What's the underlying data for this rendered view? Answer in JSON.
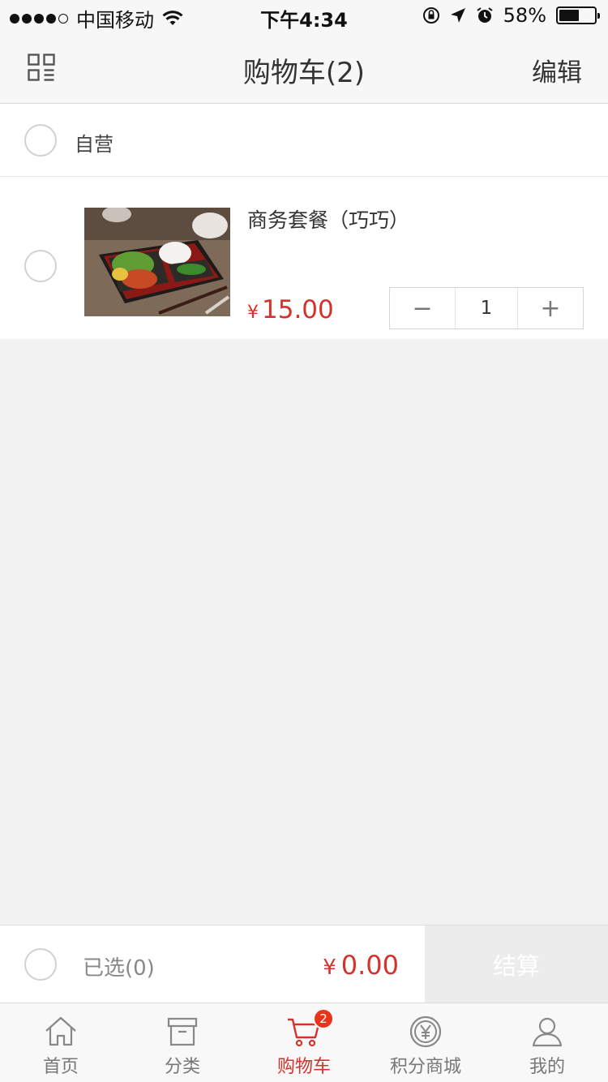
{
  "status_bar": {
    "carrier": "中国移动",
    "time": "下午4:34",
    "battery_text": "58%",
    "battery_level": 0.58,
    "signal_bars_filled": 4,
    "signal_bars_total": 5
  },
  "nav": {
    "title": "购物车(2)",
    "edit_label": "编辑",
    "left_icon": "grid-icon"
  },
  "store": {
    "name": "自营",
    "checked": false
  },
  "cart_items": [
    {
      "name": "商务套餐（巧巧）",
      "price_currency": "¥",
      "price": "15.00",
      "quantity": "1",
      "minus_label": "−",
      "plus_label": "+",
      "checked": false
    }
  ],
  "checkout": {
    "selected_label": "已选(0)",
    "total_currency": "¥",
    "total": "0.00",
    "button_label": "结算"
  },
  "tabs": [
    {
      "label": "首页",
      "icon": "home-icon",
      "active": false
    },
    {
      "label": "分类",
      "icon": "category-box-icon",
      "active": false
    },
    {
      "label": "购物车",
      "icon": "cart-icon",
      "active": true,
      "badge": "2"
    },
    {
      "label": "积分商城",
      "icon": "points-yen-icon",
      "active": false
    },
    {
      "label": "我的",
      "icon": "user-icon",
      "active": false
    }
  ],
  "colors": {
    "accent_red": "#d4322c",
    "badge_red": "#e8341c",
    "background": "#f2f2f2",
    "checkout_disabled": "#ececec"
  }
}
